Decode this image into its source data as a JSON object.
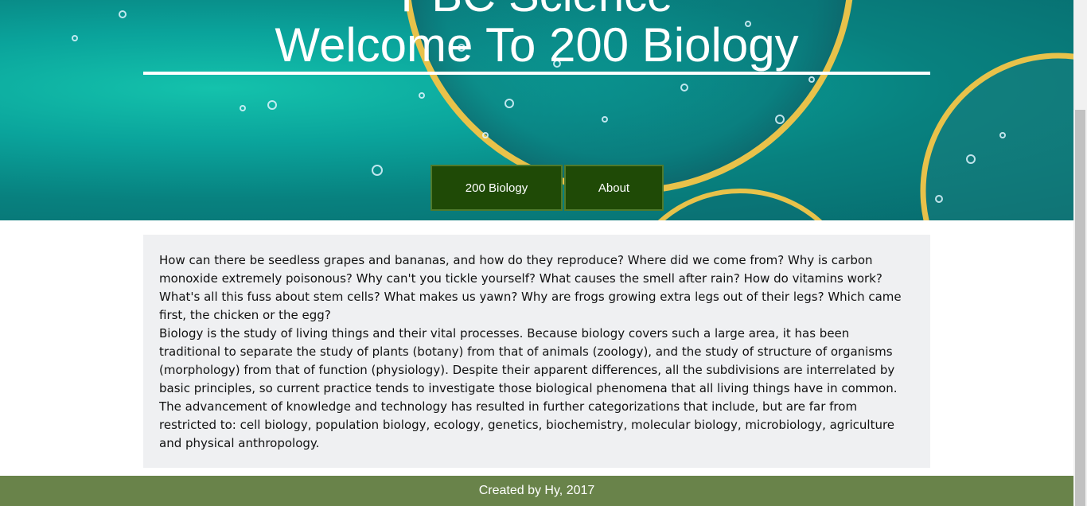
{
  "header": {
    "site_title": "PBC Science",
    "welcome_title": "Welcome To 200 Biology"
  },
  "nav": {
    "items": [
      {
        "label": "200 Biology"
      },
      {
        "label": "About"
      }
    ]
  },
  "content": {
    "intro": "How can there be seedless grapes and bananas, and how do they reproduce? Where did we come from? Why is carbon monoxide extremely poisonous? Why can't you tickle yourself? What causes the smell after rain? How do vitamins work? What's all this fuss about stem cells? What makes us yawn? Why are frogs growing extra legs out of their legs? Which came first, the chicken or the egg?",
    "body": "Biology is the study of living things and their vital processes. Because biology covers such a large area, it has been traditional to separate the study of plants (botany) from that of animals (zoology), and the study of structure of organisms (morphology) from that of function (physiology). Despite their apparent differences, all the subdivisions are interrelated by basic principles, so current practice tends to investigate those biological phenomena that all living things have in common. The advancement of knowledge and technology has resulted in further categorizations that include, but are far from restricted to: cell biology, population biology, ecology, genetics, biochemistry, molecular biology, microbiology, agriculture and physical anthropology."
  },
  "footer": {
    "text": "Created by Hy, 2017"
  },
  "colors": {
    "nav_bg": "#1f4a06",
    "footer_bg": "#69834a",
    "content_bg": "#eff0f2"
  }
}
